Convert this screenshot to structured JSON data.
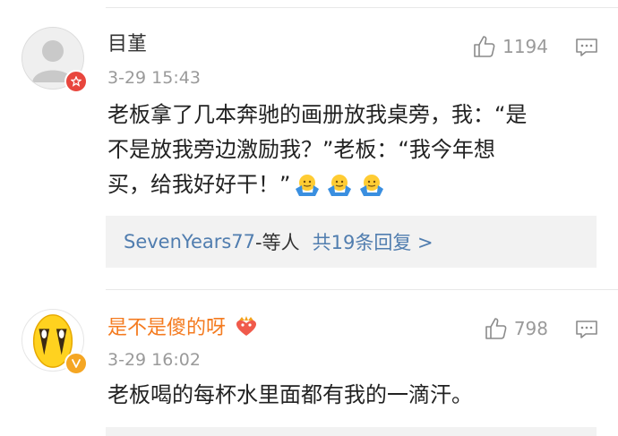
{
  "comments": [
    {
      "username": "目堇",
      "username_color": "#333333",
      "time": "3-29 15:43",
      "likes": "1194",
      "text_lines": [
        "老板拿了几本奔驰的画册放我桌旁，我：“是",
        "不是放我旁边激励我？”老板：“我今年想",
        "买，给我好好干！”"
      ],
      "emoji_icons": [
        "shrug-emoji",
        "shrug-emoji",
        "shrug-emoji"
      ],
      "replies": {
        "who": "SevenYears77",
        "sep": "-等人",
        "count": "共19条回复 >"
      },
      "avatar": "default-avatar",
      "badge_color": "#e8463d"
    },
    {
      "username": "是不是傻的呀",
      "username_color": "#f47b20",
      "time": "3-29 16:02",
      "likes": "798",
      "text_lines": [
        "老板喝的每杯水里面都有我的一滴汗。"
      ],
      "avatar": "crying-emoji-avatar",
      "badge_color": "#f5a623",
      "vip_icon": "heart-crown-icon"
    }
  ]
}
